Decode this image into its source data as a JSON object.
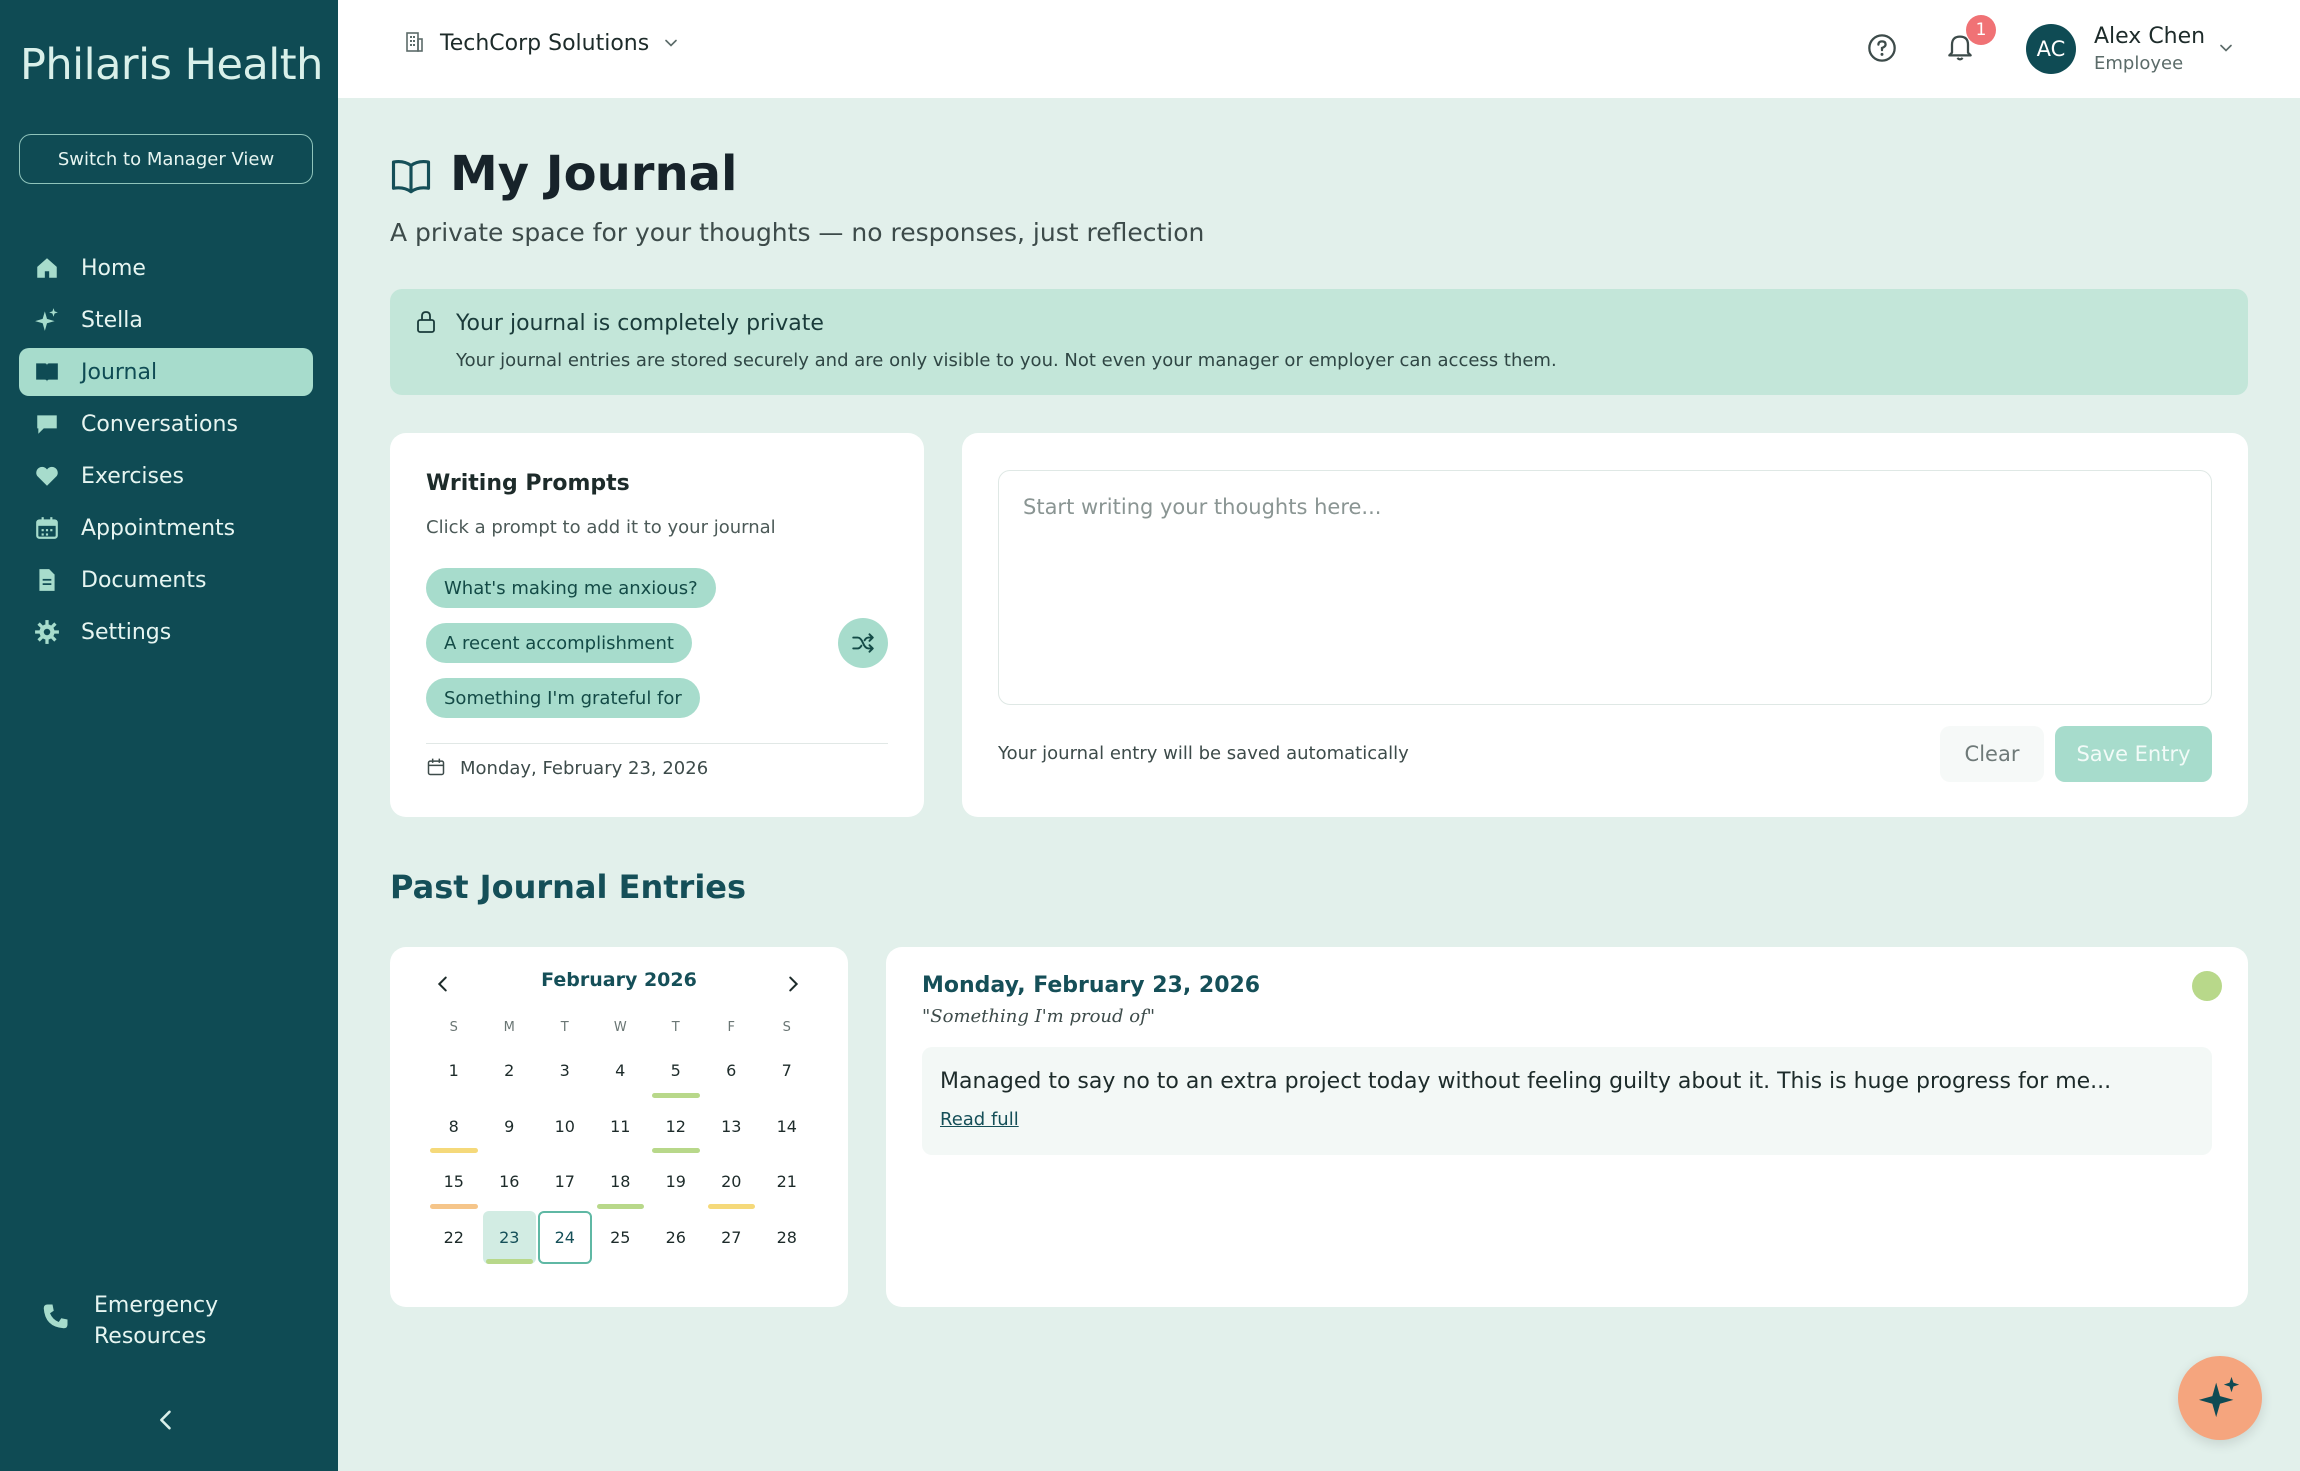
{
  "app": {
    "logo": "Philaris Health",
    "switch_view": "Switch to Manager View"
  },
  "sidebar": {
    "items": [
      {
        "label": "Home",
        "icon": "home-icon"
      },
      {
        "label": "Stella",
        "icon": "sparkle-icon"
      },
      {
        "label": "Journal",
        "icon": "book-icon",
        "active": true
      },
      {
        "label": "Conversations",
        "icon": "chat-icon"
      },
      {
        "label": "Exercises",
        "icon": "heart-icon"
      },
      {
        "label": "Appointments",
        "icon": "calendar-icon"
      },
      {
        "label": "Documents",
        "icon": "document-icon"
      },
      {
        "label": "Settings",
        "icon": "gear-icon"
      }
    ],
    "emergency_line1": "Emergency",
    "emergency_line2": "Resources"
  },
  "header": {
    "company": "TechCorp Solutions",
    "notifications": "1",
    "user_initials": "AC",
    "user_name": "Alex Chen",
    "user_role": "Employee"
  },
  "page": {
    "title": "My Journal",
    "subtitle": "A private space for your thoughts — no responses, just reflection"
  },
  "privacy": {
    "heading": "Your journal is completely private",
    "text": "Your journal entries are stored securely and are only visible to you. Not even your manager or employer can access them."
  },
  "prompts": {
    "heading": "Writing Prompts",
    "hint": "Click a prompt to add it to your journal",
    "items": [
      "What's making me anxious?",
      "A recent accomplishment",
      "Something I'm grateful for"
    ],
    "date": "Monday, February 23, 2026"
  },
  "editor": {
    "placeholder": "Start writing your thoughts here...",
    "value": "",
    "autosave": "Your journal entry will be saved automatically",
    "clear": "Clear",
    "save": "Save Entry"
  },
  "past": {
    "title": "Past Journal Entries",
    "calendar": {
      "month": "February 2026",
      "weekdays": [
        "S",
        "M",
        "T",
        "W",
        "T",
        "F",
        "S"
      ],
      "days": [
        "1",
        "2",
        "3",
        "4",
        "5",
        "6",
        "7",
        "8",
        "9",
        "10",
        "11",
        "12",
        "13",
        "14",
        "15",
        "16",
        "17",
        "18",
        "19",
        "20",
        "21",
        "22",
        "23",
        "24",
        "25",
        "26",
        "27",
        "28"
      ],
      "selected": "23",
      "today": "24",
      "entry_marks": {
        "5": "#b8d88a",
        "8": "#f5d97a",
        "12": "#b8d88a",
        "15": "#f5c58a",
        "18": "#b8d88a",
        "20": "#f5d97a",
        "23": "#b8d88a"
      }
    },
    "entry": {
      "date": "Monday, February 23, 2026",
      "prompt": "\"Something I'm proud of\"",
      "excerpt": "Managed to say no to an extra project today without feeling guilty about it. This is huge progress for me...",
      "read_full": "Read full",
      "mood_color": "#b8d88a"
    }
  },
  "colors": {
    "sidebar": "#0f4b54",
    "accent": "#a7dccc",
    "background": "#e2f0eb",
    "fab": "#f5a57e"
  }
}
